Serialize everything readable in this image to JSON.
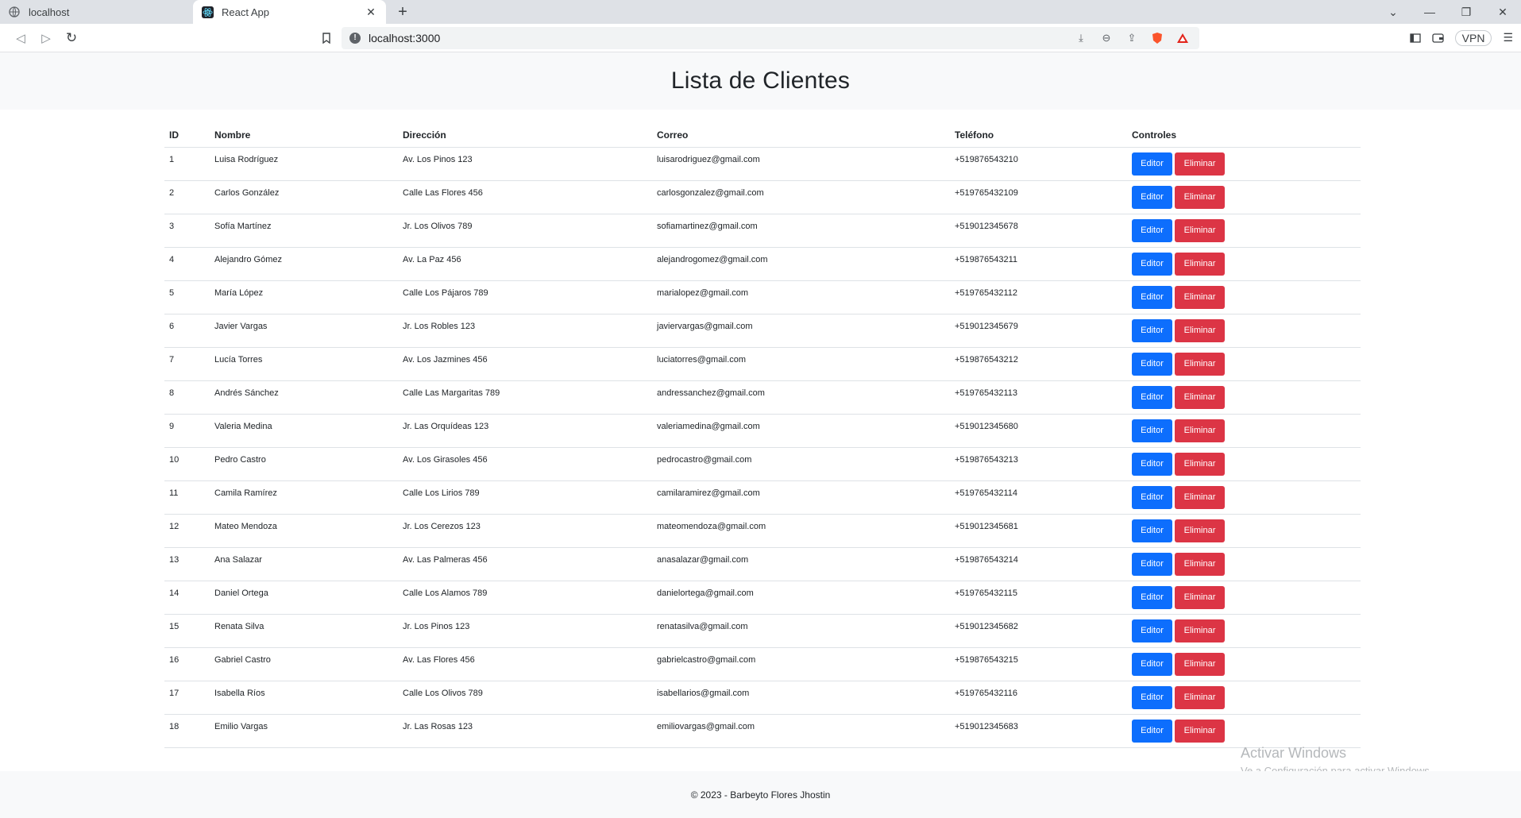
{
  "browser": {
    "tabs": [
      {
        "title": "localhost",
        "active": false
      },
      {
        "title": "React App",
        "active": true
      }
    ],
    "url": "localhost:3000",
    "vpn_label": "VPN"
  },
  "page": {
    "title": "Lista de Clientes",
    "columns": {
      "id": "ID",
      "nombre": "Nombre",
      "direccion": "Dirección",
      "correo": "Correo",
      "telefono": "Teléfono",
      "controles": "Controles"
    },
    "edit_label": "Editor",
    "delete_label": "Eliminar",
    "rows": [
      {
        "id": "1",
        "nombre": "Luisa Rodríguez",
        "direccion": "Av. Los Pinos 123",
        "correo": "luisarodriguez@gmail.com",
        "telefono": "+519876543210"
      },
      {
        "id": "2",
        "nombre": "Carlos González",
        "direccion": "Calle Las Flores 456",
        "correo": "carlosgonzalez@gmail.com",
        "telefono": "+519765432109"
      },
      {
        "id": "3",
        "nombre": "Sofía Martínez",
        "direccion": "Jr. Los Olivos 789",
        "correo": "sofiamartinez@gmail.com",
        "telefono": "+519012345678"
      },
      {
        "id": "4",
        "nombre": "Alejandro Gómez",
        "direccion": "Av. La Paz 456",
        "correo": "alejandrogomez@gmail.com",
        "telefono": "+519876543211"
      },
      {
        "id": "5",
        "nombre": "María López",
        "direccion": "Calle Los Pájaros 789",
        "correo": "marialopez@gmail.com",
        "telefono": "+519765432112"
      },
      {
        "id": "6",
        "nombre": "Javier Vargas",
        "direccion": "Jr. Los Robles 123",
        "correo": "javiervargas@gmail.com",
        "telefono": "+519012345679"
      },
      {
        "id": "7",
        "nombre": "Lucía Torres",
        "direccion": "Av. Los Jazmines 456",
        "correo": "luciatorres@gmail.com",
        "telefono": "+519876543212"
      },
      {
        "id": "8",
        "nombre": "Andrés Sánchez",
        "direccion": "Calle Las Margaritas 789",
        "correo": "andressanchez@gmail.com",
        "telefono": "+519765432113"
      },
      {
        "id": "9",
        "nombre": "Valeria Medina",
        "direccion": "Jr. Las Orquídeas 123",
        "correo": "valeriamedina@gmail.com",
        "telefono": "+519012345680"
      },
      {
        "id": "10",
        "nombre": "Pedro Castro",
        "direccion": "Av. Los Girasoles 456",
        "correo": "pedrocastro@gmail.com",
        "telefono": "+519876543213"
      },
      {
        "id": "11",
        "nombre": "Camila Ramírez",
        "direccion": "Calle Los Lirios 789",
        "correo": "camilaramirez@gmail.com",
        "telefono": "+519765432114"
      },
      {
        "id": "12",
        "nombre": "Mateo Mendoza",
        "direccion": "Jr. Los Cerezos 123",
        "correo": "mateomendoza@gmail.com",
        "telefono": "+519012345681"
      },
      {
        "id": "13",
        "nombre": "Ana Salazar",
        "direccion": "Av. Las Palmeras 456",
        "correo": "anasalazar@gmail.com",
        "telefono": "+519876543214"
      },
      {
        "id": "14",
        "nombre": "Daniel Ortega",
        "direccion": "Calle Los Alamos 789",
        "correo": "danielortega@gmail.com",
        "telefono": "+519765432115"
      },
      {
        "id": "15",
        "nombre": "Renata Silva",
        "direccion": "Jr. Los Pinos 123",
        "correo": "renatasilva@gmail.com",
        "telefono": "+519012345682"
      },
      {
        "id": "16",
        "nombre": "Gabriel Castro",
        "direccion": "Av. Las Flores 456",
        "correo": "gabrielcastro@gmail.com",
        "telefono": "+519876543215"
      },
      {
        "id": "17",
        "nombre": "Isabella Ríos",
        "direccion": "Calle Los Olivos 789",
        "correo": "isabellarios@gmail.com",
        "telefono": "+519765432116"
      },
      {
        "id": "18",
        "nombre": "Emilio Vargas",
        "direccion": "Jr. Las Rosas 123",
        "correo": "emiliovargas@gmail.com",
        "telefono": "+519012345683"
      }
    ],
    "footer": "© 2023 - Barbeyto Flores Jhostin"
  },
  "os_overlay": {
    "line1": "Activar Windows",
    "line2": "Ve a Configuración para activar Windows."
  },
  "colors": {
    "edit_button": "#0d6efd",
    "delete_button": "#dc3545",
    "header_bg": "#f8f9fa"
  }
}
